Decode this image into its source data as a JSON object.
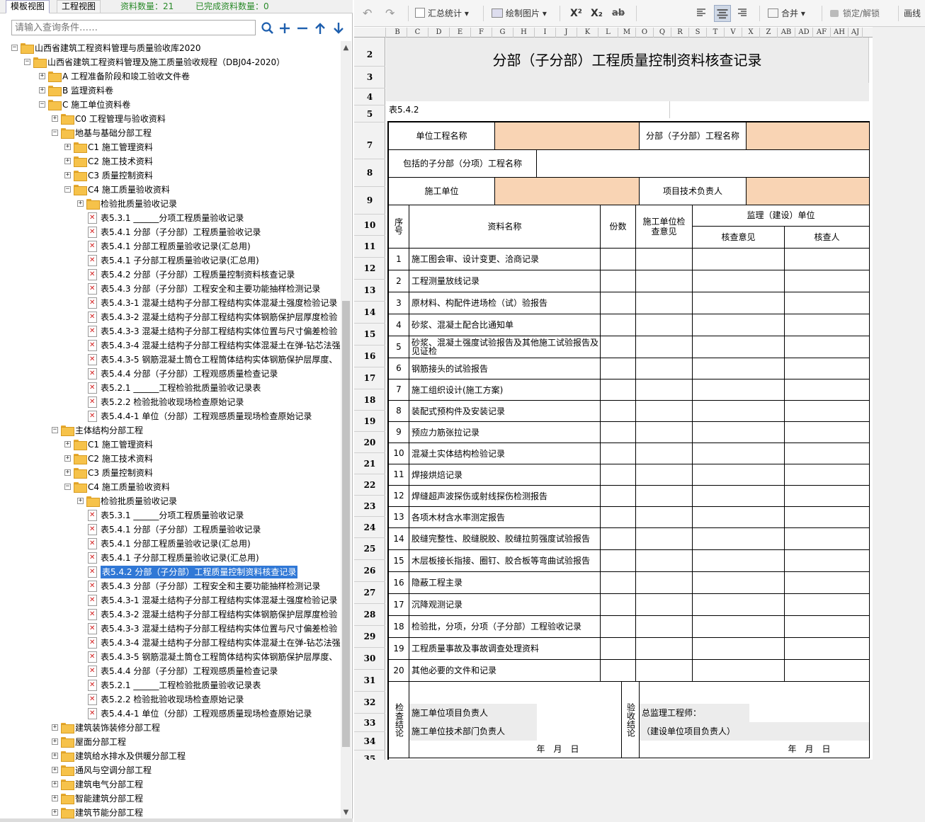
{
  "left_panel": {
    "tabs": [
      "模板视图",
      "工程视图"
    ],
    "stats": {
      "count_label": "资料数量：21",
      "done_label": "已完成资料数量：0"
    },
    "search_placeholder": "请输入查询条件……",
    "tree": [
      {
        "text": "山西省建筑工程资料管理与质量验收库2020",
        "level": 0,
        "type": "folder",
        "expanded": true
      },
      {
        "text": "山西省建筑工程资料管理及施工质量验收规程（DBJ04-2020）",
        "level": 1,
        "type": "folder",
        "expanded": true
      },
      {
        "text": "A 工程准备阶段和竣工验收文件卷",
        "level": 2,
        "type": "folder",
        "expanded": false
      },
      {
        "text": "B 监理资料卷",
        "level": 2,
        "type": "folder",
        "expanded": false
      },
      {
        "text": "C 施工单位资料卷",
        "level": 2,
        "type": "folder",
        "expanded": true
      },
      {
        "text": "C0 工程管理与验收资料",
        "level": 3,
        "type": "folder",
        "expanded": false
      },
      {
        "text": "地基与基础分部工程",
        "level": 3,
        "type": "folder",
        "expanded": true
      },
      {
        "text": "C1 施工管理资料",
        "level": 4,
        "type": "folder",
        "expanded": false
      },
      {
        "text": "C2 施工技术资料",
        "level": 4,
        "type": "folder",
        "expanded": false
      },
      {
        "text": "C3 质量控制资料",
        "level": 4,
        "type": "folder",
        "expanded": false
      },
      {
        "text": "C4 施工质量验收资料",
        "level": 4,
        "type": "folder",
        "expanded": true
      },
      {
        "text": "检验批质量验收记录",
        "level": 5,
        "type": "folder",
        "expanded": false
      },
      {
        "text": "表5.3.1 ______分项工程质量验收记录",
        "level": 5,
        "type": "doc"
      },
      {
        "text": "表5.4.1 分部（子分部）工程质量验收记录",
        "level": 5,
        "type": "doc"
      },
      {
        "text": "表5.4.1 分部工程质量验收记录(汇总用)",
        "level": 5,
        "type": "doc"
      },
      {
        "text": "表5.4.1 子分部工程质量验收记录(汇总用)",
        "level": 5,
        "type": "doc"
      },
      {
        "text": "表5.4.2 分部（子分部）工程质量控制资料核查记录",
        "level": 5,
        "type": "doc"
      },
      {
        "text": "表5.4.3 分部（子分部）工程安全和主要功能抽样检测记录",
        "level": 5,
        "type": "doc"
      },
      {
        "text": "表5.4.3-1 混凝土结构子分部工程结构实体混凝土强度检验记录",
        "level": 5,
        "type": "doc"
      },
      {
        "text": "表5.4.3-2 混凝土结构子分部工程结构实体钢筋保护层厚度检验",
        "level": 5,
        "type": "doc"
      },
      {
        "text": "表5.4.3-3 混凝土结构子分部工程结构实体位置与尺寸偏差检验",
        "level": 5,
        "type": "doc"
      },
      {
        "text": "表5.4.3-4 混凝土结构子分部工程结构实体混凝土在弹-钻芯法强",
        "level": 5,
        "type": "doc"
      },
      {
        "text": "表5.4.3-5 钢筋混凝土筒仓工程筒体结构实体钢筋保护层厚度、",
        "level": 5,
        "type": "doc"
      },
      {
        "text": "表5.4.4 分部（子分部）工程观感质量检查记录",
        "level": 5,
        "type": "doc"
      },
      {
        "text": "表5.2.1 ______工程检验批质量验收记录表",
        "level": 5,
        "type": "doc"
      },
      {
        "text": "表5.2.2 检验批验收现场检查原始记录",
        "level": 5,
        "type": "doc"
      },
      {
        "text": "表5.4.4-1 单位（分部）工程观感质量现场检查原始记录",
        "level": 5,
        "type": "doc"
      },
      {
        "text": "主体结构分部工程",
        "level": 3,
        "type": "folder",
        "expanded": true
      },
      {
        "text": "C1 施工管理资料",
        "level": 4,
        "type": "folder",
        "expanded": false
      },
      {
        "text": "C2 施工技术资料",
        "level": 4,
        "type": "folder",
        "expanded": false
      },
      {
        "text": "C3 质量控制资料",
        "level": 4,
        "type": "folder",
        "expanded": false
      },
      {
        "text": "C4 施工质量验收资料",
        "level": 4,
        "type": "folder",
        "expanded": true
      },
      {
        "text": "检验批质量验收记录",
        "level": 5,
        "type": "folder",
        "expanded": false
      },
      {
        "text": "表5.3.1 ______分项工程质量验收记录",
        "level": 5,
        "type": "doc"
      },
      {
        "text": "表5.4.1 分部（子分部）工程质量验收记录",
        "level": 5,
        "type": "doc"
      },
      {
        "text": "表5.4.1 分部工程质量验收记录(汇总用)",
        "level": 5,
        "type": "doc"
      },
      {
        "text": "表5.4.1 子分部工程质量验收记录(汇总用)",
        "level": 5,
        "type": "doc"
      },
      {
        "text": "表5.4.2 分部（子分部）工程质量控制资料核查记录",
        "level": 5,
        "type": "doc",
        "selected": true
      },
      {
        "text": "表5.4.3 分部（子分部）工程安全和主要功能抽样检测记录",
        "level": 5,
        "type": "doc"
      },
      {
        "text": "表5.4.3-1 混凝土结构子分部工程结构实体混凝土强度检验记录",
        "level": 5,
        "type": "doc"
      },
      {
        "text": "表5.4.3-2 混凝土结构子分部工程结构实体钢筋保护层厚度检验",
        "level": 5,
        "type": "doc"
      },
      {
        "text": "表5.4.3-3 混凝土结构子分部工程结构实体位置与尺寸偏差检验",
        "level": 5,
        "type": "doc"
      },
      {
        "text": "表5.4.3-4 混凝土结构子分部工程结构实体混凝土在弹-钻芯法强",
        "level": 5,
        "type": "doc"
      },
      {
        "text": "表5.4.3-5 钢筋混凝土筒仓工程筒体结构实体钢筋保护层厚度、",
        "level": 5,
        "type": "doc"
      },
      {
        "text": "表5.4.4 分部（子分部）工程观感质量检查记录",
        "level": 5,
        "type": "doc"
      },
      {
        "text": "表5.2.1 ______工程检验批质量验收记录表",
        "level": 5,
        "type": "doc"
      },
      {
        "text": "表5.2.2 检验批验收现场检查原始记录",
        "level": 5,
        "type": "doc"
      },
      {
        "text": "表5.4.4-1 单位（分部）工程观感质量现场检查原始记录",
        "level": 5,
        "type": "doc"
      },
      {
        "text": "建筑装饰装修分部工程",
        "level": 3,
        "type": "folder",
        "expanded": false
      },
      {
        "text": "屋面分部工程",
        "level": 3,
        "type": "folder",
        "expanded": false
      },
      {
        "text": "建筑给水排水及供暖分部工程",
        "level": 3,
        "type": "folder",
        "expanded": false
      },
      {
        "text": "通风与空调分部工程",
        "level": 3,
        "type": "folder",
        "expanded": false
      },
      {
        "text": "建筑电气分部工程",
        "level": 3,
        "type": "folder",
        "expanded": false
      },
      {
        "text": "智能建筑分部工程",
        "level": 3,
        "type": "folder",
        "expanded": false
      },
      {
        "text": "建筑节能分部工程",
        "level": 3,
        "type": "folder",
        "expanded": false
      }
    ]
  },
  "toolbar": {
    "undo_icon": "undo-icon",
    "redo_icon": "redo-icon",
    "summary": "汇总统计",
    "draw_image": "绘制图片",
    "superscript": "X²",
    "subscript": "X₂",
    "strikethrough": "ab",
    "merge": "合并",
    "lock": "锁定/解锁",
    "draw_line": "画线"
  },
  "sheet": {
    "columns": [
      "B",
      "C",
      "D",
      "E",
      "F",
      "G",
      "H",
      "I",
      "J",
      "K",
      "L",
      "M",
      "O",
      "Q",
      "R",
      "S",
      "T",
      "V",
      "X",
      "Z",
      "AB",
      "AD",
      "AF",
      "AH",
      "AJ"
    ],
    "row_numbers": [
      "2",
      "3",
      "4",
      "5",
      "7",
      "8",
      "9",
      "10",
      "11",
      "12",
      "13",
      "14",
      "15",
      "16",
      "17",
      "18",
      "19",
      "20",
      "21",
      "22",
      "23",
      "24",
      "25",
      "26",
      "27",
      "28",
      "29",
      "30",
      "31",
      "32",
      "33",
      "34",
      "35"
    ],
    "title": "分部（子分部）工程质量控制资料核查记录",
    "table_no": "表5.4.2",
    "unit_project_label": "单位工程名称",
    "sub_project_label": "分部（子分部）工程名称",
    "included_label": "包括的子分部（分项）工程名称",
    "contractor_label": "施工单位",
    "tech_lead_label": "项目技术负责人",
    "headers": {
      "seq": "序号",
      "name": "资料名称",
      "copies": "份数",
      "contractor_opinion": "施工单位检查意见",
      "supervisor": "监理（建设）单位",
      "check_opinion": "核查意见",
      "checker": "核查人"
    },
    "items": [
      {
        "no": "1",
        "name": "施工图会审、设计变更、洽商记录"
      },
      {
        "no": "2",
        "name": "工程测量放线记录"
      },
      {
        "no": "3",
        "name": "原材料、构配件进场检（试）验报告"
      },
      {
        "no": "4",
        "name": "砂浆、混凝土配合比通知单"
      },
      {
        "no": "5",
        "name": "砂浆、混凝土强度试验报告及其他施工试验报告及见证检"
      },
      {
        "no": "6",
        "name": "钢筋接头的试验报告"
      },
      {
        "no": "7",
        "name": "施工组织设计(施工方案)"
      },
      {
        "no": "8",
        "name": "装配式预构件及安装记录"
      },
      {
        "no": "9",
        "name": "预应力筋张拉记录"
      },
      {
        "no": "10",
        "name": "混凝土实体结构检验记录"
      },
      {
        "no": "11",
        "name": "焊接烘焙记录"
      },
      {
        "no": "12",
        "name": "焊缝超声波探伤或射线探伤检测报告"
      },
      {
        "no": "13",
        "name": "各项木材含水率测定报告"
      },
      {
        "no": "14",
        "name": "胶缝完整性、胶缝脱胶、胶缝拉剪强度试验报告"
      },
      {
        "no": "15",
        "name": "木层板接长指接、圈钉、胶合板等弯曲试验报告"
      },
      {
        "no": "16",
        "name": "隐蔽工程主录"
      },
      {
        "no": "17",
        "name": "沉降观测记录"
      },
      {
        "no": "18",
        "name": "检验批，分项，分项（子分部）工程验收记录"
      },
      {
        "no": "19",
        "name": "工程质量事故及事故调查处理资料"
      },
      {
        "no": "20",
        "name": "其他必要的文件和记录"
      }
    ],
    "check_conclusion": "检查结论",
    "accept_conclusion": "验收结论",
    "project_manager": "施工单位项目负责人",
    "tech_dept_head": "施工单位技术部门负责人",
    "chief_supervisor": "总监理工程师：",
    "owner_lead": "（建设单位项目负责人）",
    "date_left": "年　月　日",
    "date_right": "年　月　日"
  }
}
